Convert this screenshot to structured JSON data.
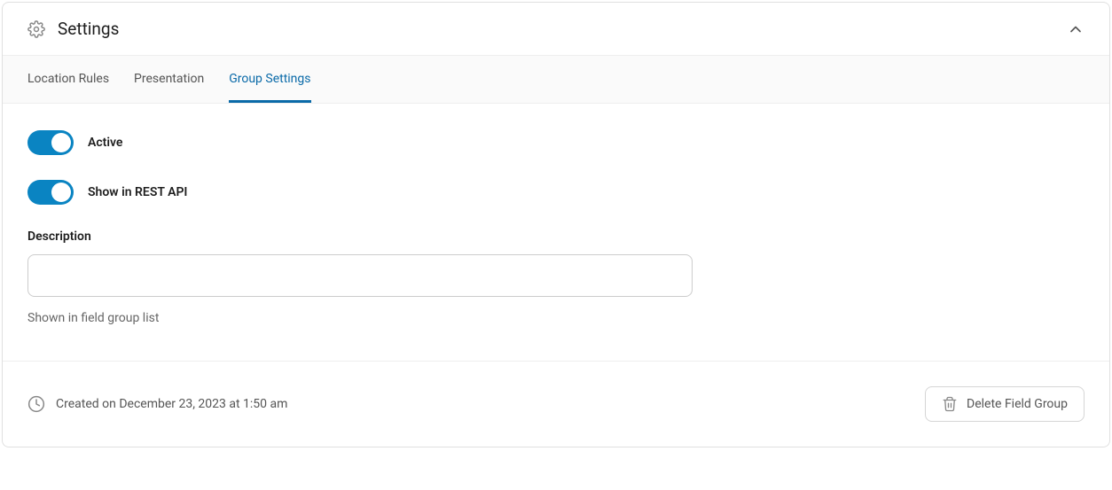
{
  "header": {
    "title": "Settings"
  },
  "tabs": [
    {
      "label": "Location Rules"
    },
    {
      "label": "Presentation"
    },
    {
      "label": "Group Settings"
    }
  ],
  "toggles": {
    "active": {
      "label": "Active",
      "on": true
    },
    "rest": {
      "label": "Show in REST API",
      "on": true
    }
  },
  "description": {
    "label": "Description",
    "value": "",
    "help": "Shown in field group list"
  },
  "footer": {
    "created": "Created on December 23, 2023 at 1:50 am",
    "delete_label": "Delete Field Group"
  }
}
